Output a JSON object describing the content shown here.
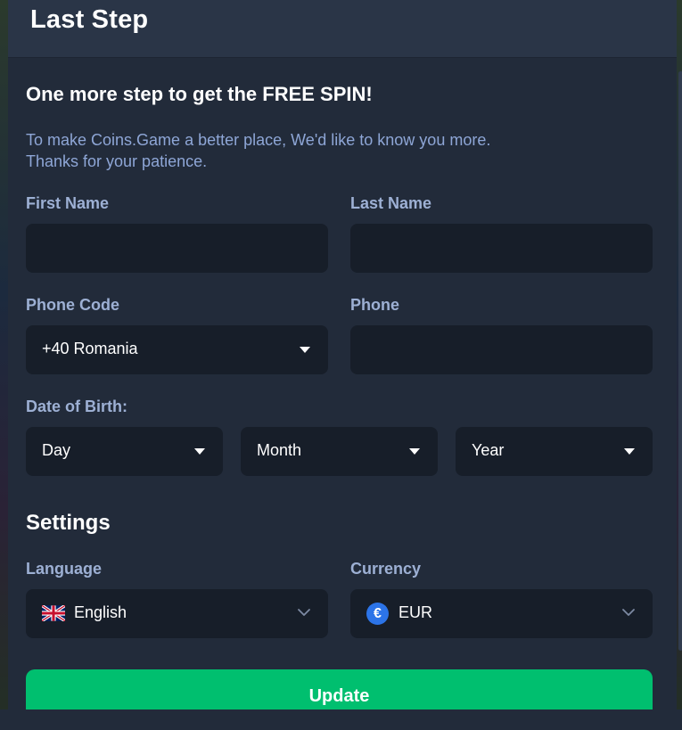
{
  "modal": {
    "title": "Last Step",
    "heading": "One more step to get the FREE SPIN!",
    "description_line1": "To make Coins.Game a better place, We'd like to know you more.",
    "description_line2": "Thanks for your patience."
  },
  "form": {
    "first_name_label": "First Name",
    "first_name_value": "",
    "last_name_label": "Last Name",
    "last_name_value": "",
    "phone_code_label": "Phone Code",
    "phone_code_value": "+40 Romania",
    "phone_label": "Phone",
    "phone_value": "",
    "dob_label": "Date of Birth:",
    "day_value": "Day",
    "month_value": "Month",
    "year_value": "Year"
  },
  "settings": {
    "title": "Settings",
    "language_label": "Language",
    "language_value": "English",
    "language_icon": "uk-flag-icon",
    "currency_label": "Currency",
    "currency_value": "EUR",
    "currency_icon": "euro-coin-icon",
    "currency_symbol": "€"
  },
  "actions": {
    "update_label": "Update"
  },
  "colors": {
    "accent": "#00bf6f",
    "panel": "#222b3a",
    "field": "#171e29",
    "label": "#9db0d4",
    "description": "#8ea6d6"
  }
}
